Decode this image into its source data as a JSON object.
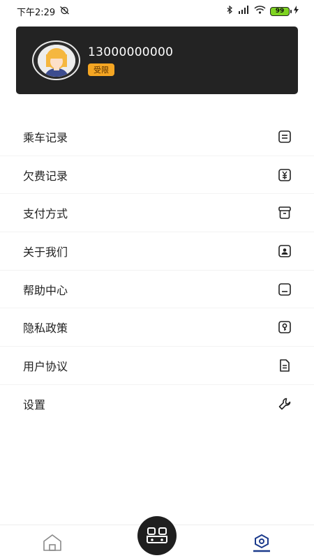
{
  "status_bar": {
    "time": "下午2:29",
    "battery": "99"
  },
  "profile": {
    "phone": "13000000000",
    "badge": "受限"
  },
  "menu": [
    {
      "label": "乘车记录",
      "icon": "document-icon"
    },
    {
      "label": "欠费记录",
      "icon": "yuan-receipt-icon"
    },
    {
      "label": "支付方式",
      "icon": "payment-box-icon"
    },
    {
      "label": "关于我们",
      "icon": "contact-card-icon"
    },
    {
      "label": "帮助中心",
      "icon": "help-panel-icon"
    },
    {
      "label": "隐私政策",
      "icon": "lock-key-icon"
    },
    {
      "label": "用户协议",
      "icon": "agreement-document-icon"
    },
    {
      "label": "设置",
      "icon": "wrench-icon"
    }
  ],
  "colors": {
    "card_bg": "#232323",
    "badge_bg": "#f5a623",
    "active_tab": "#1b3a8c"
  }
}
